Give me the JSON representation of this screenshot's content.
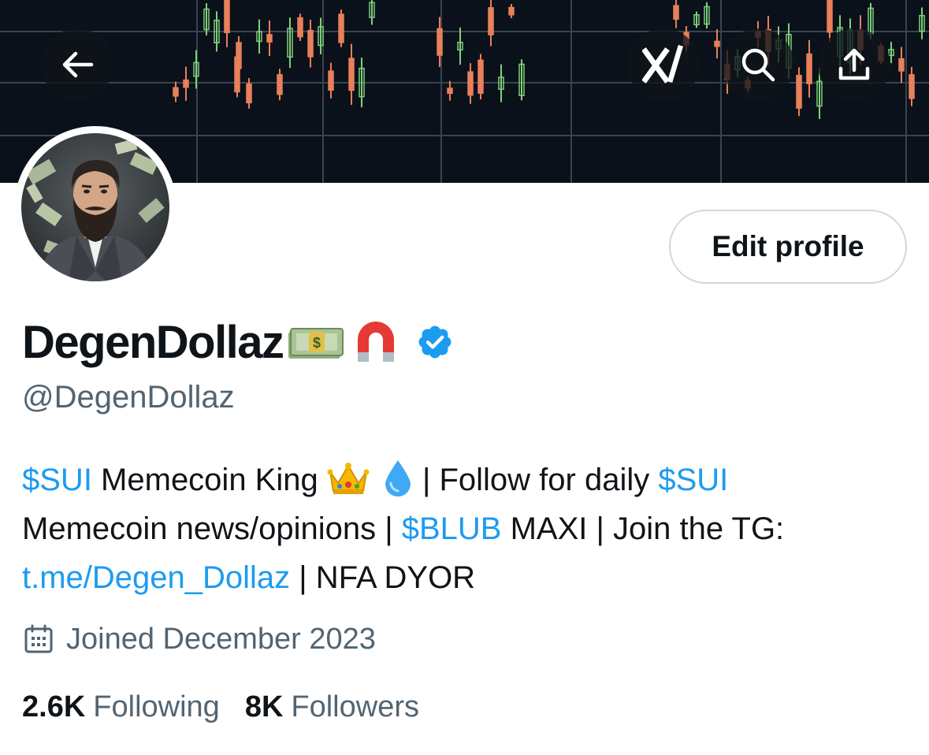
{
  "header": {
    "back_icon": "arrow-left-icon",
    "grok_icon": "grok-icon",
    "search_icon": "search-icon",
    "share_icon": "share-icon"
  },
  "profile": {
    "display_name": "DegenDollaz",
    "name_emojis": [
      "money-bill-emoji",
      "magnet-emoji"
    ],
    "verified_badge": "verified-badge-icon",
    "handle": "@DegenDollaz",
    "edit_button_label": "Edit profile"
  },
  "bio": {
    "line1": {
      "t1": "$SUI",
      "t2": " Memecoin King ",
      "t3": " | Follow for daily ",
      "t4": "$SUI"
    },
    "line2": {
      "t1": "Memecoin news/opinions | ",
      "t2": "$BLUB",
      "t3": " MAXI | Join the TG:"
    },
    "line3": {
      "t1": "t.me/Degen_Dollaz",
      "t2": " | NFA DYOR"
    }
  },
  "joined": {
    "icon": "calendar-icon",
    "text": "Joined December 2023"
  },
  "stats": {
    "following_count": "2.6K",
    "following_label": "Following",
    "followers_count": "8K",
    "followers_label": "Followers"
  },
  "colors": {
    "link": "#1d9bf0",
    "secondary_text": "#536471",
    "verified": "#1d9bf0",
    "banner_bg": "#0b111a",
    "candle_up": "#7ed17a",
    "candle_down": "#e8805a"
  }
}
